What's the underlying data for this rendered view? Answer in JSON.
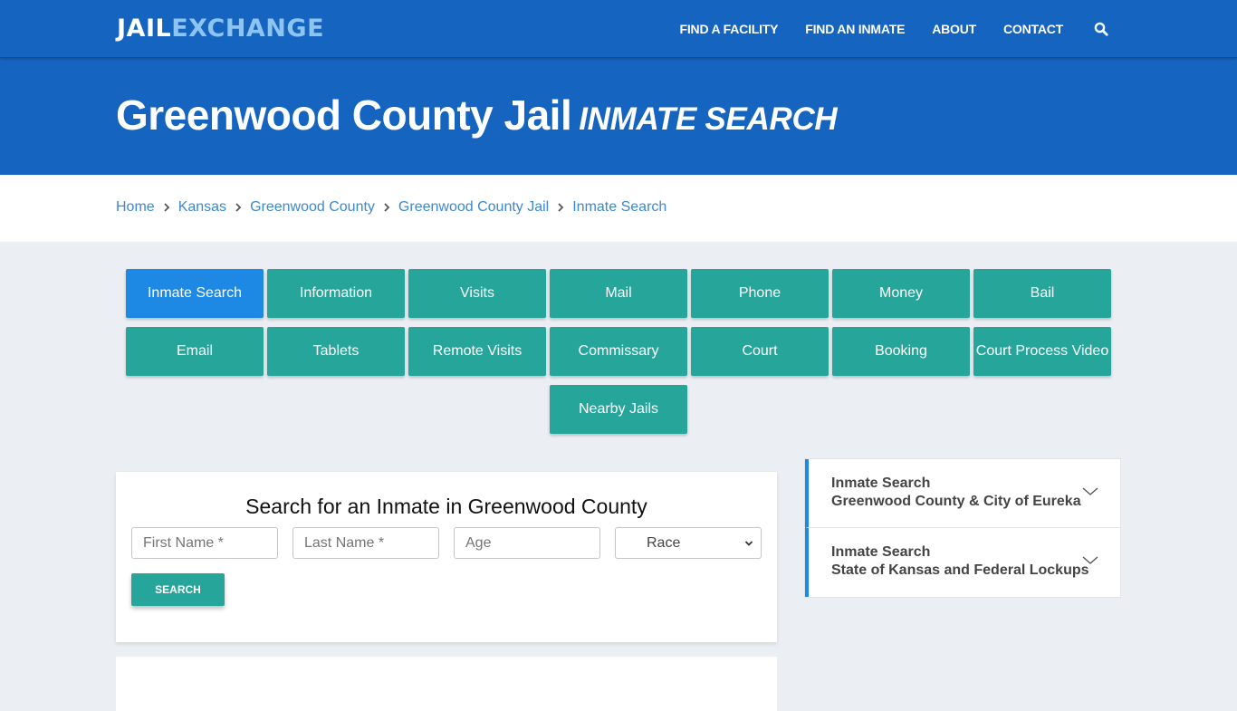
{
  "header": {
    "logo_part1": "JAIL",
    "logo_part2": "EXCHANGE",
    "nav": [
      {
        "label": "FIND A FACILITY"
      },
      {
        "label": "FIND AN INMATE"
      },
      {
        "label": "ABOUT"
      },
      {
        "label": "CONTACT"
      }
    ],
    "search_icon": "search-icon"
  },
  "hero": {
    "title": "Greenwood County Jail",
    "subtitle": "INMATE SEARCH"
  },
  "breadcrumb": [
    {
      "label": "Home"
    },
    {
      "label": "Kansas"
    },
    {
      "label": "Greenwood County"
    },
    {
      "label": "Greenwood County Jail"
    },
    {
      "label": "Inmate Search"
    }
  ],
  "tiles": [
    {
      "label": "Inmate Search",
      "active": true
    },
    {
      "label": "Information"
    },
    {
      "label": "Visits"
    },
    {
      "label": "Mail"
    },
    {
      "label": "Phone"
    },
    {
      "label": "Money"
    },
    {
      "label": "Bail"
    },
    {
      "label": "Email"
    },
    {
      "label": "Tablets"
    },
    {
      "label": "Remote Visits"
    },
    {
      "label": "Commissary"
    },
    {
      "label": "Court"
    },
    {
      "label": "Booking"
    },
    {
      "label": "Court Process Video"
    },
    {
      "label": "Nearby Jails"
    }
  ],
  "search_form": {
    "title": "Search for an Inmate in Greenwood County",
    "first_name_placeholder": "First Name *",
    "last_name_placeholder": "Last Name *",
    "age_placeholder": "Age",
    "race_selected": "Race",
    "submit_label": "SEARCH"
  },
  "sidebar": {
    "items": [
      {
        "line1": "Inmate Search",
        "line2": "Greenwood County & City of Eureka"
      },
      {
        "line1": "Inmate Search",
        "line2": "State of Kansas and Federal Lockups"
      }
    ]
  },
  "colors": {
    "brand_blue": "#1565c0",
    "logo_light": "#8ec4f2",
    "tile_teal": "#26a69a",
    "tile_active": "#1e88e5",
    "link_blue": "#3d88d3"
  }
}
